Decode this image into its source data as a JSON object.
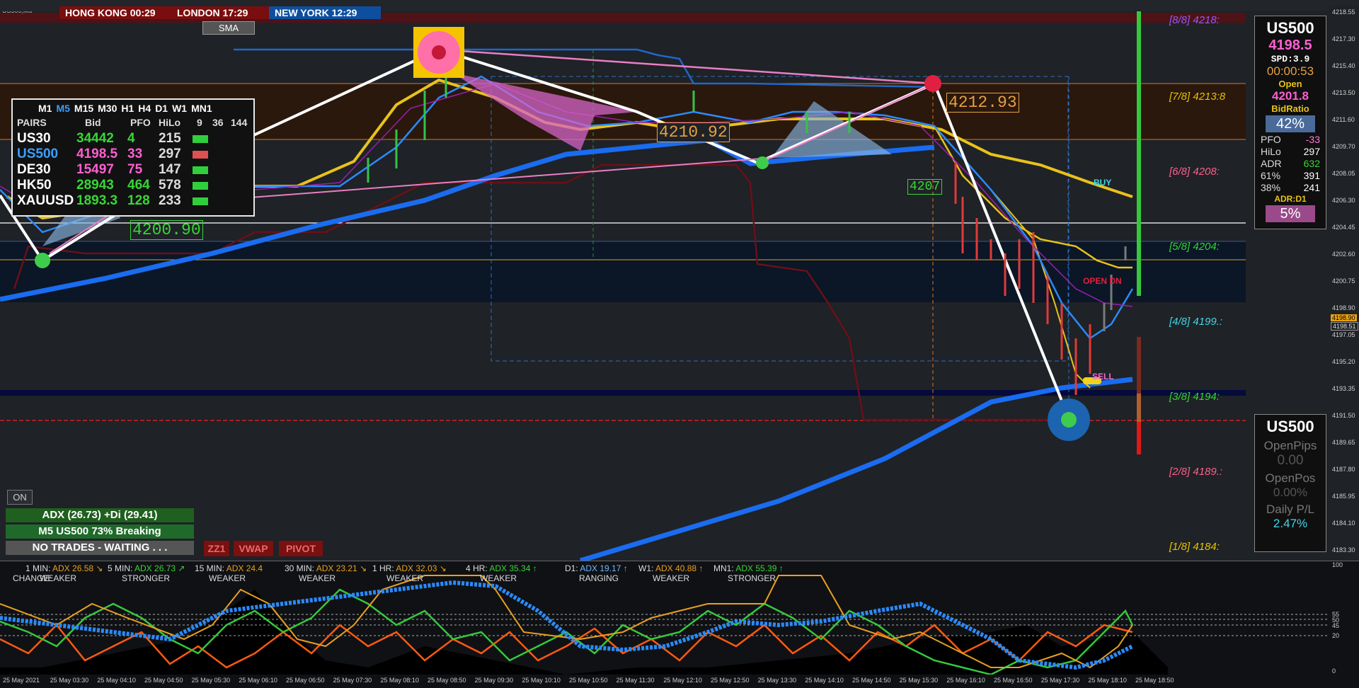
{
  "window": {
    "symbol_label": "US500,M5"
  },
  "clocks": [
    {
      "label": "HONG KONG 00:29",
      "bg": "#7a0d0d"
    },
    {
      "label": "LONDON  17:29",
      "bg": "#7a0d0d"
    },
    {
      "label": "NEW YORK 12:29",
      "bg": "#0d4f9e"
    }
  ],
  "sma_button": "SMA",
  "pairs_panel": {
    "timeframes": [
      {
        "label": "M1",
        "active": false
      },
      {
        "label": "M5",
        "active": true
      },
      {
        "label": "M15",
        "active": false
      },
      {
        "label": "M30",
        "active": false
      },
      {
        "label": "H1",
        "active": false
      },
      {
        "label": "H4",
        "active": false
      },
      {
        "label": "D1",
        "active": false
      },
      {
        "label": "W1",
        "active": false
      },
      {
        "label": "MN1",
        "active": false
      }
    ],
    "headers": [
      "PAIRS",
      "Bid",
      "PFO",
      "HiLo",
      "9",
      "36",
      "144"
    ],
    "rows": [
      {
        "pair": "US30",
        "bid": "34442",
        "pfo": "4",
        "hilo": "215",
        "pair_color": "#ffffff",
        "bid_color": "#37d737",
        "pfo_color": "#37d737",
        "cells": [
          "#2fcf3c",
          "#2fcf3c",
          "#2fcf3c"
        ]
      },
      {
        "pair": "US500",
        "bid": "4198.5",
        "pfo": "33",
        "hilo": "297",
        "pair_color": "#3aa0ff",
        "bid_color": "#ff5fd0",
        "pfo_color": "#ff5fd0",
        "cells": [
          "#2fcf3c",
          "#2fcf3c",
          "#e05050"
        ]
      },
      {
        "pair": "DE30",
        "bid": "15497",
        "pfo": "75",
        "hilo": "147",
        "pair_color": "#ffffff",
        "bid_color": "#ff5fd0",
        "pfo_color": "#ff5fd0",
        "cells": [
          "#2fcf3c",
          "#2fcf3c",
          "#2fcf3c"
        ]
      },
      {
        "pair": "HK50",
        "bid": "28943",
        "pfo": "464",
        "hilo": "578",
        "pair_color": "#ffffff",
        "bid_color": "#37d737",
        "pfo_color": "#37d737",
        "cells": [
          "#2fcf3c",
          "#e05050",
          "#2fcf3c"
        ]
      },
      {
        "pair": "XAUUSD",
        "bid": "1893.3",
        "pfo": "128",
        "hilo": "233",
        "pair_color": "#ffffff",
        "bid_color": "#37d737",
        "pfo_color": "#37d737",
        "cells": [
          "#2fcf3c",
          "#2fcf3c",
          "#2fcf3c"
        ]
      }
    ]
  },
  "chart_labels": {
    "left_price": "4200.90",
    "mid_price": "4210.92",
    "right_price": "4212.93",
    "partial_price": "4207",
    "buy": "BUY",
    "sell": "SELL",
    "open_dn": "OPEN  DN"
  },
  "murrey": [
    {
      "label": "[8/8]  4218:",
      "color": "#8a5cff"
    },
    {
      "label": "[7/8]  4213:8",
      "color": "#e6c200"
    },
    {
      "label": "[6/8]  4208:",
      "color": "#ff5f8a"
    },
    {
      "label": "[5/8]  4204:",
      "color": "#33d433"
    },
    {
      "label": "[4/8]  4199.:",
      "color": "#3fd7e6"
    },
    {
      "label": "[3/8]  4194:",
      "color": "#33d433"
    },
    {
      "label": "[2/8]  4189.:",
      "color": "#ff5f8a"
    },
    {
      "label": "[1/8]  4184:",
      "color": "#e6c200"
    }
  ],
  "price_scale": [
    "4218.55",
    "4217.30",
    "4215.40",
    "4213.50",
    "4211.60",
    "4209.70",
    "4208.05",
    "4206.30",
    "4204.45",
    "4202.60",
    "4200.75",
    "4198.90",
    "4197.05",
    "4195.20",
    "4193.35",
    "4191.50",
    "4189.65",
    "4187.80",
    "4185.95",
    "4184.10",
    "4183.30"
  ],
  "price_scale_current": [
    "4198.90",
    "4198.51"
  ],
  "info_panel": {
    "symbol": "US500",
    "bid": "4198.5",
    "spd": "SPD:3.9",
    "timer": "00:00:53",
    "open_label": "Open",
    "open_value": "4201.8",
    "bidratio_label": "BidRatio",
    "bidratio_value": "42%",
    "stats": [
      {
        "k": "PFO",
        "v": "-33",
        "vc": "#ff7cd6"
      },
      {
        "k": "HiLo",
        "v": "297",
        "vc": "#ffffff"
      },
      {
        "k": "ADR",
        "v": "632",
        "vc": "#37d737"
      },
      {
        "k": "61%",
        "v": "391",
        "vc": "#ffffff"
      },
      {
        "k": "38%",
        "v": "241",
        "vc": "#ffffff"
      }
    ],
    "adr_label": "ADR:D1",
    "adr_pct": "5%"
  },
  "pl_panel": {
    "symbol": "US500",
    "open_pips_label": "OpenPips",
    "open_pips_value": "0.00",
    "open_pos_label": "OpenPos",
    "open_pos_value": "0.00%",
    "daily_pl_label": "Daily P/L",
    "daily_pl_value": "2.47%"
  },
  "status": {
    "on": "ON",
    "adx_line": "ADX (26.73)    +Di (29.41)",
    "breaking": "M5 US500 73% Breaking",
    "waiting": "NO TRADES - WAITING . . .",
    "zz1": "ZZ1",
    "vwap": "VWAP",
    "pivot": "PIVOT"
  },
  "adx_strip": [
    {
      "tf": "1 MIN:",
      "val": "ADX 26.58",
      "arrow": "↘",
      "state": "WEAKER"
    },
    {
      "tf": "5 MIN:",
      "val": "ADX 26.73",
      "arrow": "↗",
      "state": "STRONGER"
    },
    {
      "tf": "15 MIN:",
      "val": "ADX 24.4",
      "arrow": "",
      "state": "WEAKER"
    },
    {
      "tf": "30 MIN:",
      "val": "ADX 23.21",
      "arrow": "↘",
      "state": "WEAKER"
    },
    {
      "tf": "1 HR:",
      "val": "ADX 32.03",
      "arrow": "↘",
      "state": "WEAKER"
    },
    {
      "tf": "4 HR:",
      "val": "ADX 35.34",
      "arrow": "↑",
      "state": "WEAKER"
    },
    {
      "tf": "D1:",
      "val": "ADX 19.17",
      "arrow": "↑",
      "state": "RANGING"
    },
    {
      "tf": "W1:",
      "val": "ADX 40.88",
      "arrow": "↑",
      "state": "WEAKER"
    },
    {
      "tf": "MN1:",
      "val": "ADX 55.39",
      "arrow": "↑",
      "state": "STRONGER"
    }
  ],
  "change_label": "CHANGE:",
  "ind_scale": [
    "100",
    "55",
    "50",
    "45",
    "20",
    "0"
  ],
  "time_axis": [
    "25 May 2021",
    "25 May 03:30",
    "25 May 04:10",
    "25 May 04:50",
    "25 May 05:30",
    "25 May 06:10",
    "25 May 06:50",
    "25 May 07:30",
    "25 May 08:10",
    "25 May 08:50",
    "25 May 09:30",
    "25 May 10:10",
    "25 May 10:50",
    "25 May 11:30",
    "25 May 12:10",
    "25 May 12:50",
    "25 May 13:30",
    "25 May 14:10",
    "25 May 14:50",
    "25 May 15:30",
    "25 May 16:10",
    "25 May 16:50",
    "25 May 17:30",
    "25 May 18:10",
    "25 May 18:50"
  ]
}
